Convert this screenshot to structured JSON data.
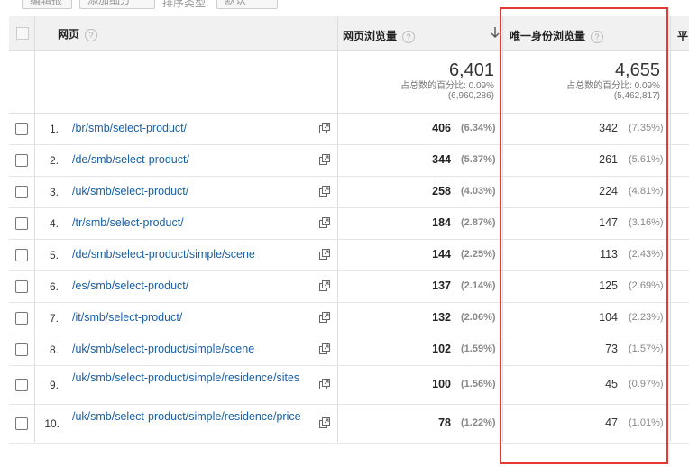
{
  "toolbar": {
    "b1": "编辑报告",
    "b2": "添加细分",
    "b3": "排序类型:",
    "b4": "默认"
  },
  "columns": {
    "page": "网页",
    "pageviews": "网页浏览量",
    "unique": "唯一身份浏览量",
    "avg": "平"
  },
  "sort_icon": "arrow-down",
  "totals": {
    "pageviews": "6,401",
    "pageviews_sub1": "占总数的百分比: 0.09%",
    "pageviews_sub2": "(6,960,286)",
    "unique": "4,655",
    "unique_sub1": "占总数的百分比: 0.09%",
    "unique_sub2": "(5,462,817)"
  },
  "rows": [
    {
      "idx": "1.",
      "page": "/br/smb/select-product/",
      "pv": "406",
      "pvp": "(6.34%)",
      "uv": "342",
      "uvp": "(7.35%)"
    },
    {
      "idx": "2.",
      "page": "/de/smb/select-product/",
      "pv": "344",
      "pvp": "(5.37%)",
      "uv": "261",
      "uvp": "(5.61%)"
    },
    {
      "idx": "3.",
      "page": "/uk/smb/select-product/",
      "pv": "258",
      "pvp": "(4.03%)",
      "uv": "224",
      "uvp": "(4.81%)"
    },
    {
      "idx": "4.",
      "page": "/tr/smb/select-product/",
      "pv": "184",
      "pvp": "(2.87%)",
      "uv": "147",
      "uvp": "(3.16%)"
    },
    {
      "idx": "5.",
      "page": "/de/smb/select-product/simple/scene",
      "pv": "144",
      "pvp": "(2.25%)",
      "uv": "113",
      "uvp": "(2.43%)"
    },
    {
      "idx": "6.",
      "page": "/es/smb/select-product/",
      "pv": "137",
      "pvp": "(2.14%)",
      "uv": "125",
      "uvp": "(2.69%)"
    },
    {
      "idx": "7.",
      "page": "/it/smb/select-product/",
      "pv": "132",
      "pvp": "(2.06%)",
      "uv": "104",
      "uvp": "(2.23%)"
    },
    {
      "idx": "8.",
      "page": "/uk/smb/select-product/simple/scene",
      "pv": "102",
      "pvp": "(1.59%)",
      "uv": "73",
      "uvp": "(1.57%)"
    },
    {
      "idx": "9.",
      "page": "/uk/smb/select-product/simple/residence/sites",
      "pv": "100",
      "pvp": "(1.56%)",
      "uv": "45",
      "uvp": "(0.97%)"
    },
    {
      "idx": "10.",
      "page": "/uk/smb/select-product/simple/residence/price",
      "pv": "78",
      "pvp": "(1.22%)",
      "uv": "47",
      "uvp": "(1.01%)"
    }
  ],
  "colors": {
    "link": "#1a5fa6",
    "highlight": "#e53935",
    "header_bg": "#f1f1f1"
  }
}
